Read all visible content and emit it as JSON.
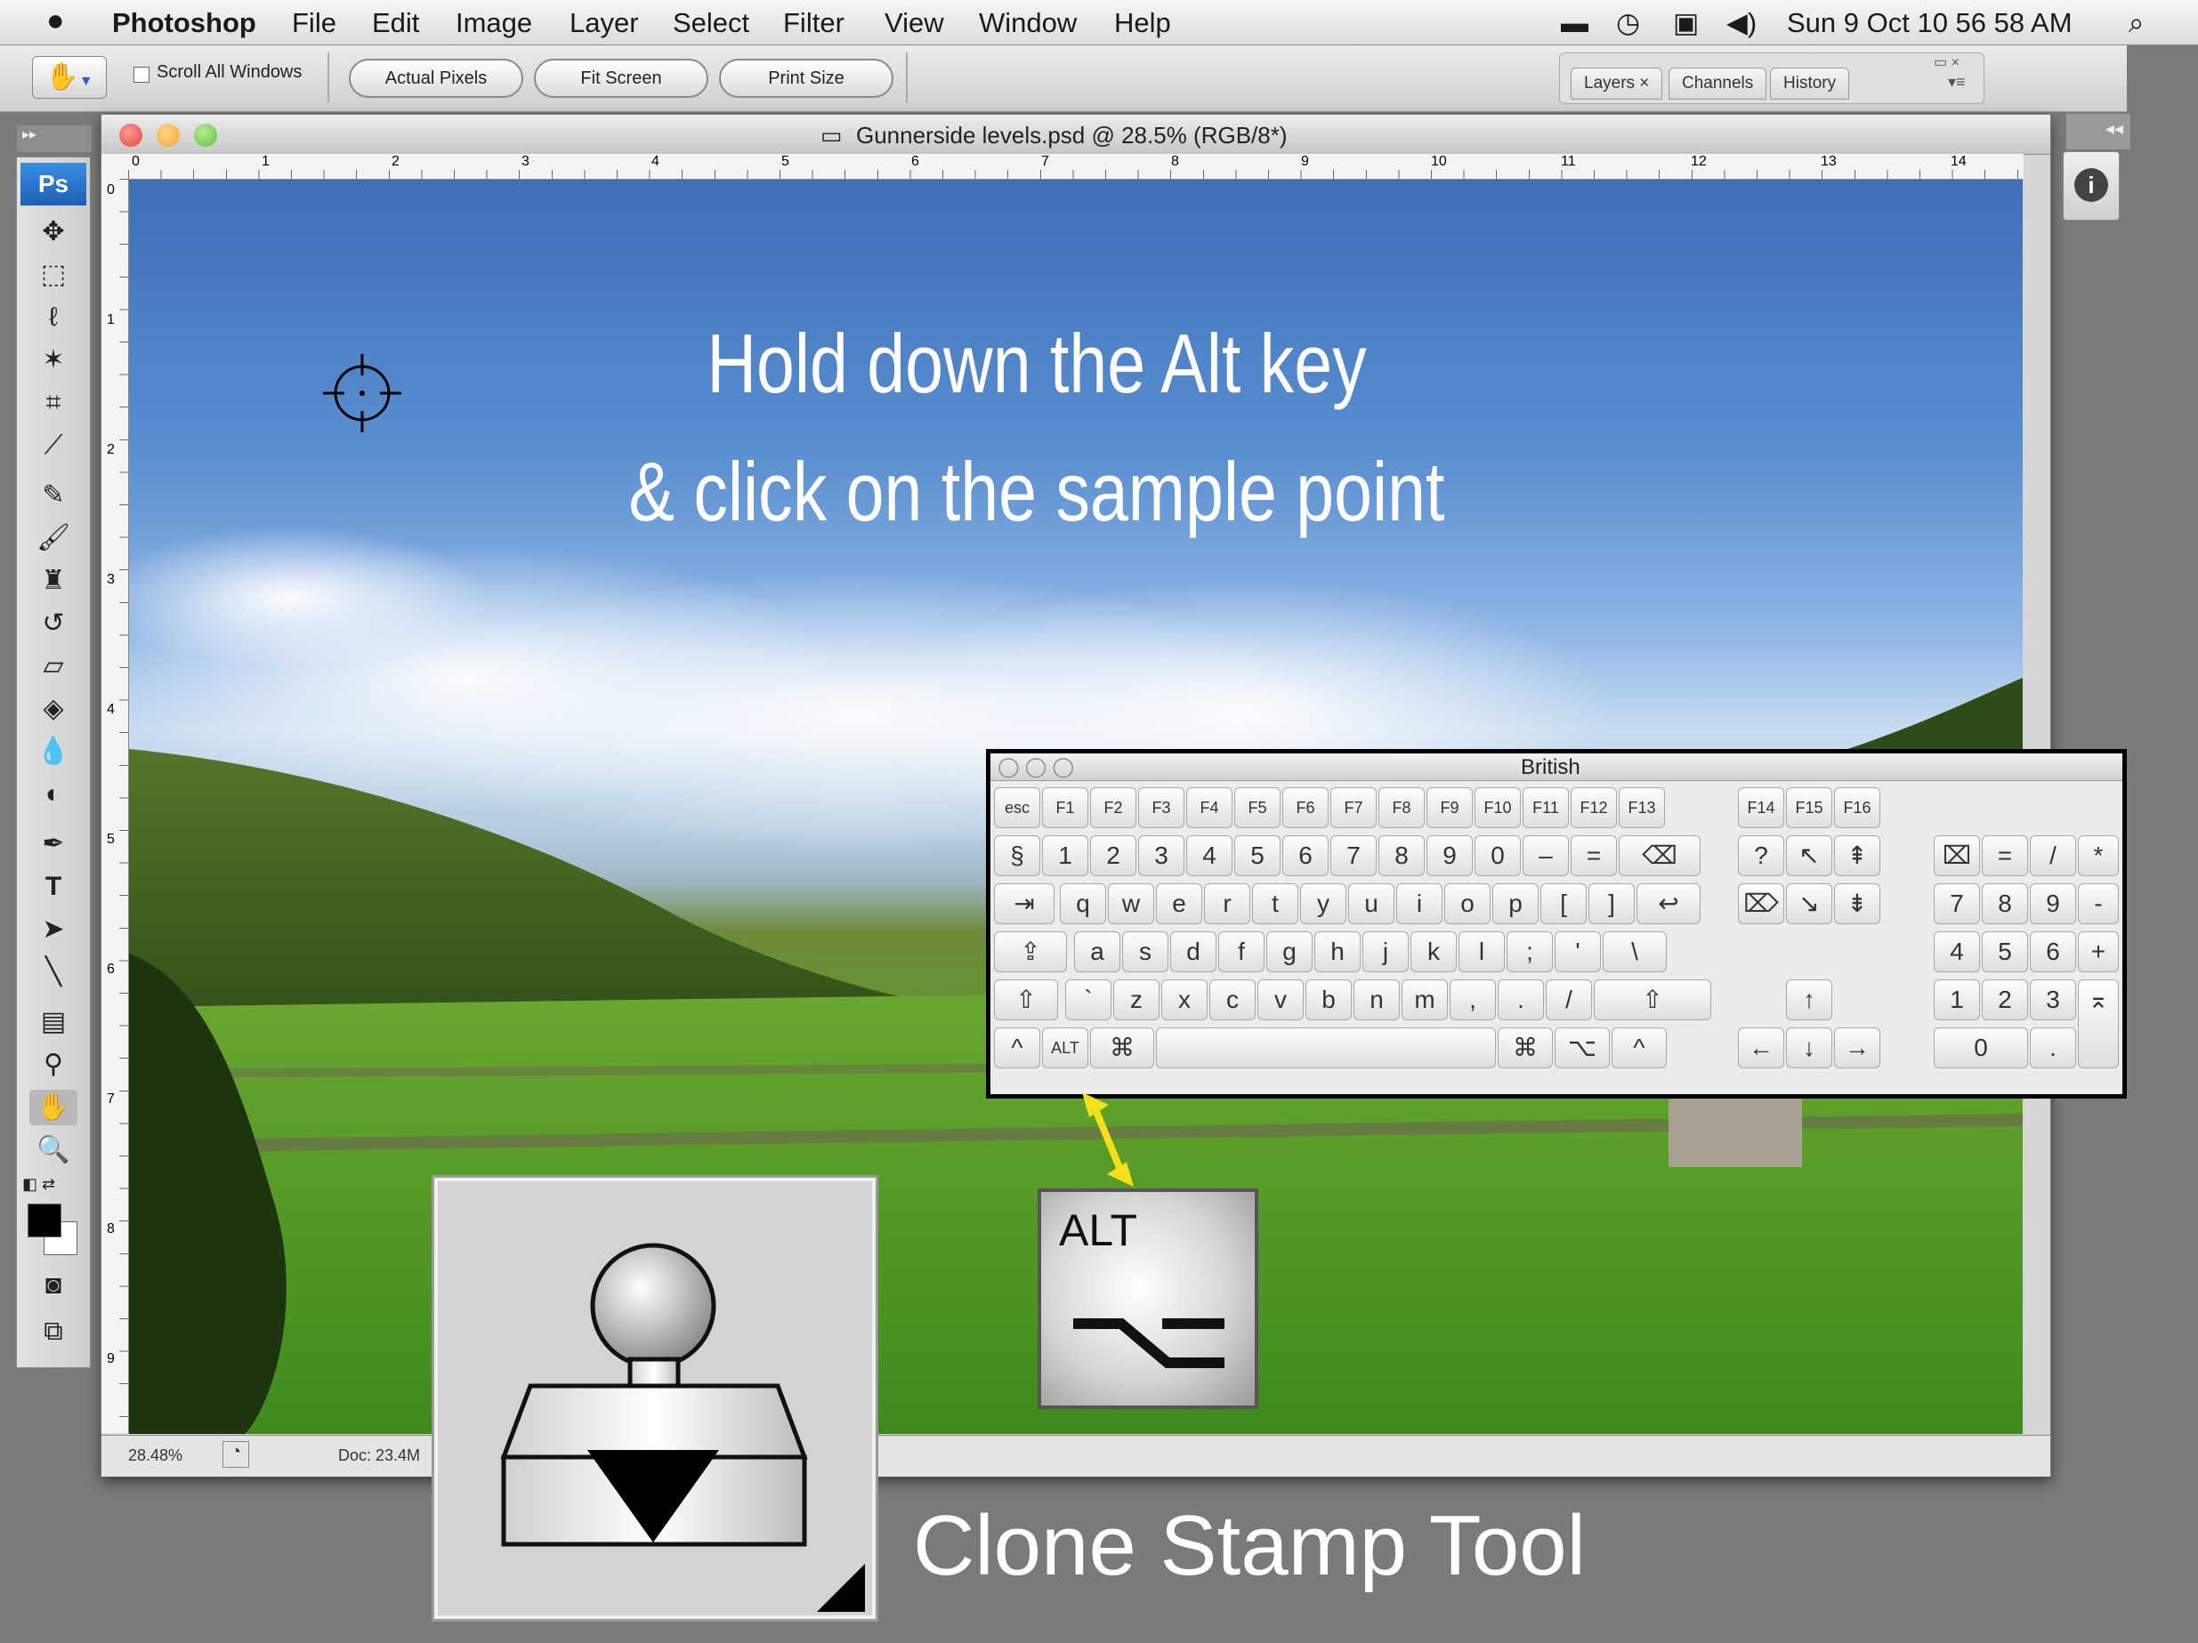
{
  "menubar": {
    "apple": "",
    "app": "Photoshop",
    "items": [
      "File",
      "Edit",
      "Image",
      "Layer",
      "Select",
      "Filter",
      "View",
      "Window",
      "Help"
    ],
    "clock": "Sun 9 Oct  10 56 58 AM"
  },
  "options": {
    "scroll_all": "Scroll All Windows",
    "actual_pixels": "Actual Pixels",
    "fit_screen": "Fit Screen",
    "print_size": "Print Size",
    "panel_tabs": [
      "Layers",
      "Channels",
      "History"
    ]
  },
  "toolbox": {
    "logo": "Ps"
  },
  "document": {
    "title": "Gunnerside levels.psd @ 28.5% (RGB/8*)",
    "ruler_h": [
      "0",
      "1",
      "2",
      "3",
      "4",
      "5",
      "6",
      "7",
      "8",
      "9",
      "10",
      "11",
      "12",
      "13",
      "14"
    ],
    "ruler_v": [
      "0",
      "1",
      "2",
      "3",
      "4",
      "5",
      "6",
      "7",
      "8",
      "9"
    ],
    "zoom": "28.48%",
    "doc_size": "Doc: 23.4M"
  },
  "overlay": {
    "line1": "Hold down the Alt key",
    "line2": "& click on the sample point"
  },
  "keyboard": {
    "title": "British",
    "fkeys": [
      "esc",
      "F1",
      "F2",
      "F3",
      "F4",
      "F5",
      "F6",
      "F7",
      "F8",
      "F9",
      "F10",
      "F11",
      "F12",
      "F13"
    ],
    "fkeys2": [
      "F14",
      "F15",
      "F16"
    ],
    "row1": [
      "§",
      "1",
      "2",
      "3",
      "4",
      "5",
      "6",
      "7",
      "8",
      "9",
      "0",
      "–",
      "=",
      "⌫"
    ],
    "row2": [
      "⇥",
      "q",
      "w",
      "e",
      "r",
      "t",
      "y",
      "u",
      "i",
      "o",
      "p",
      "[",
      "]",
      "↩"
    ],
    "row3": [
      "⇪",
      "a",
      "s",
      "d",
      "f",
      "g",
      "h",
      "j",
      "k",
      "l",
      ";",
      "'",
      "\\"
    ],
    "row4": [
      "⇧",
      "`",
      "z",
      "x",
      "c",
      "v",
      "b",
      "n",
      "m",
      ",",
      ".",
      "/",
      "⇧"
    ],
    "row5": [
      "^",
      "ALT",
      "⌘",
      "",
      "⌘",
      "⌥",
      "^"
    ],
    "nav1": [
      "?",
      "↖",
      "⇞"
    ],
    "nav2": [
      "⌦",
      "↘",
      "⇟"
    ],
    "arrows": [
      "↑",
      "←",
      "↓",
      "→"
    ],
    "numpad": [
      "⌧",
      "=",
      "/",
      "*",
      "7",
      "8",
      "9",
      "-",
      "4",
      "5",
      "6",
      "+",
      "1",
      "2",
      "3",
      "⌅",
      "0",
      "."
    ]
  },
  "alt_callout": {
    "label": "ALT",
    "symbol": "⌥"
  },
  "caption": "Clone Stamp Tool",
  "colors": {
    "accent_arrow": "#f2e01c",
    "traffic_red": "#e0443e",
    "traffic_yellow": "#f0a52b",
    "traffic_green": "#5fc03b"
  }
}
